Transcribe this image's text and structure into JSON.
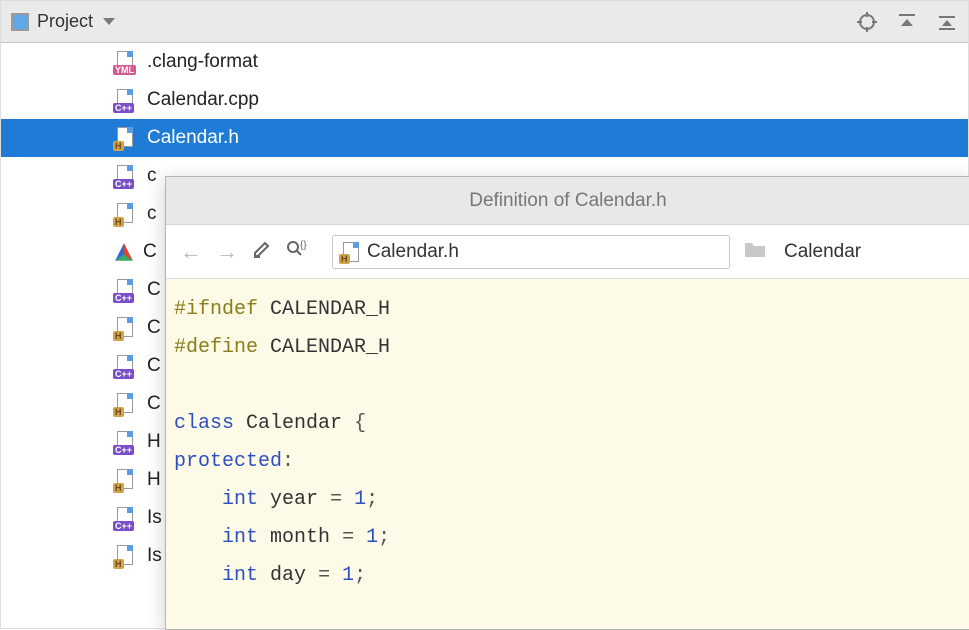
{
  "toolbar": {
    "title": "Project"
  },
  "files": [
    {
      "name": ".clang-format",
      "type": "yml"
    },
    {
      "name": "Calendar.cpp",
      "type": "cpp"
    },
    {
      "name": "Calendar.h",
      "type": "h",
      "selected": true
    },
    {
      "name": "c",
      "type": "cpp"
    },
    {
      "name": "c",
      "type": "h"
    },
    {
      "name": "C",
      "type": "cmake"
    },
    {
      "name": "C",
      "type": "cpp"
    },
    {
      "name": "C",
      "type": "h"
    },
    {
      "name": "C",
      "type": "cpp"
    },
    {
      "name": "C",
      "type": "h"
    },
    {
      "name": "H",
      "type": "cpp"
    },
    {
      "name": "H",
      "type": "h"
    },
    {
      "name": "Is",
      "type": "cpp"
    },
    {
      "name": "Is",
      "type": "h"
    }
  ],
  "popup": {
    "title": "Definition of Calendar.h",
    "file_field": "Calendar.h",
    "breadcrumb": "Calendar"
  },
  "code": {
    "l1_kw": "#ifndef",
    "l1_id": "CALENDAR_H",
    "l2_kw": "#define",
    "l2_id": "CALENDAR_H",
    "l3_kw": "class",
    "l3_id": "Calendar",
    "l3_brace": "{",
    "l4_kw": "protected",
    "l4_colon": ":",
    "l5_kw": "int",
    "l5_id": "year",
    "l5_eq": "=",
    "l5_val": "1",
    "l5_sc": ";",
    "l6_kw": "int",
    "l6_id": "month",
    "l6_eq": "=",
    "l6_val": "1",
    "l6_sc": ";",
    "l7_kw": "int",
    "l7_id": "day",
    "l7_eq": "=",
    "l7_val": "1",
    "l7_sc": ";"
  },
  "icon_badges": {
    "yml": "YML",
    "cpp": "C++",
    "h": "H"
  }
}
